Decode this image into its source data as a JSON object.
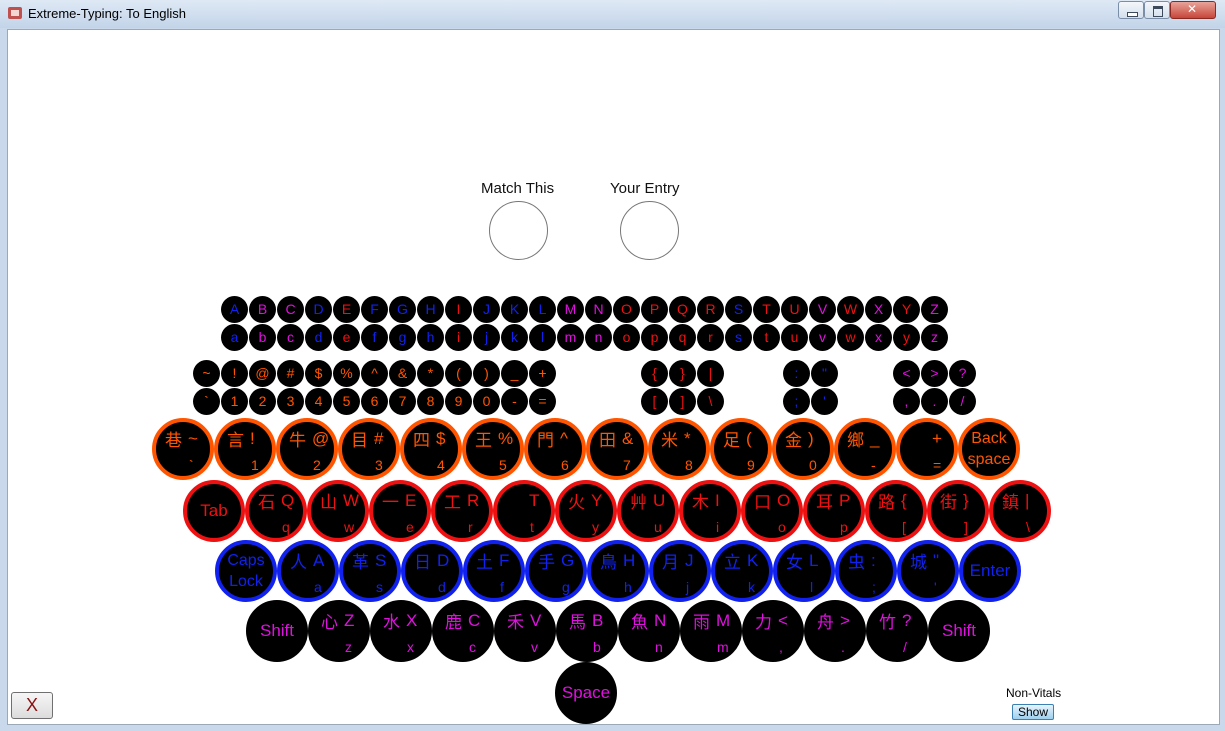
{
  "window": {
    "title": "Extreme-Typing: To English"
  },
  "labels": {
    "match": "Match This",
    "entry": "Your Entry"
  },
  "footer": {
    "close_label": "X",
    "nonvitals_label": "Non-Vitals",
    "show_label": "Show"
  },
  "colors": {
    "orange": "#ff5500",
    "red": "#ee1111",
    "blue": "#1122ee",
    "magenta": "#e010e0",
    "gray": "#888888"
  },
  "letters_upper": [
    "A",
    "B",
    "C",
    "D",
    "E",
    "F",
    "G",
    "H",
    "I",
    "J",
    "K",
    "L",
    "M",
    "N",
    "O",
    "P",
    "Q",
    "R",
    "S",
    "T",
    "U",
    "V",
    "W",
    "X",
    "Y",
    "Z"
  ],
  "letters_lower": [
    "a",
    "b",
    "c",
    "d",
    "e",
    "f",
    "g",
    "h",
    "i",
    "j",
    "k",
    "l",
    "m",
    "n",
    "o",
    "p",
    "q",
    "r",
    "s",
    "t",
    "u",
    "v",
    "w",
    "x",
    "y",
    "z"
  ],
  "letters_colors": [
    "blue",
    "magenta",
    "magenta",
    "blue",
    "red",
    "blue",
    "blue",
    "blue",
    "red",
    "blue",
    "blue",
    "blue",
    "magenta",
    "magenta",
    "red",
    "red",
    "red",
    "red",
    "blue",
    "red",
    "red",
    "magenta",
    "red",
    "magenta",
    "red",
    "magenta"
  ],
  "symbols_top": [
    "~",
    "!",
    "@",
    "#",
    "$",
    "%",
    "^",
    "&",
    "*",
    "(",
    ")",
    "_",
    "+"
  ],
  "symbols_bottom": [
    "`",
    "1",
    "2",
    "3",
    "4",
    "5",
    "6",
    "7",
    "8",
    "9",
    "0",
    "-",
    "="
  ],
  "brackets_top": [
    "{",
    "}",
    "|"
  ],
  "brackets_bottom": [
    "[",
    "]",
    "\\"
  ],
  "punct_top": [
    ":",
    "\""
  ],
  "punct_bottom": [
    ";",
    "'"
  ],
  "angle_top": [
    "<",
    ">",
    "?"
  ],
  "angle_bottom": [
    ",",
    ".",
    "/"
  ],
  "row_number": [
    {
      "t": "巷",
      "tr": "~",
      "bl": "`"
    },
    {
      "t": "言",
      "tr": "!",
      "bl": "1"
    },
    {
      "t": "牛",
      "tr": "@",
      "bl": "2"
    },
    {
      "t": "目",
      "tr": "#",
      "bl": "3"
    },
    {
      "t": "四",
      "tr": "$",
      "bl": "4"
    },
    {
      "t": "王",
      "tr": "%",
      "bl": "5"
    },
    {
      "t": "門",
      "tr": "^",
      "bl": "6"
    },
    {
      "t": "田",
      "tr": "&",
      "bl": "7"
    },
    {
      "t": "米",
      "tr": "*",
      "bl": "8"
    },
    {
      "t": "足",
      "tr": "(",
      "bl": "9"
    },
    {
      "t": "金",
      "tr": ")",
      "bl": "0"
    },
    {
      "t": "鄉",
      "tr": "_",
      "bl": "-"
    },
    {
      "t": "",
      "tr": "+",
      "bl": "="
    }
  ],
  "backspace_label": "Back space",
  "tab_label": "Tab",
  "row_top": [
    {
      "t": "石",
      "tr": "Q",
      "bl": "q"
    },
    {
      "t": "山",
      "tr": "W",
      "bl": "w"
    },
    {
      "t": "一",
      "tr": "E",
      "bl": "e"
    },
    {
      "t": "工",
      "tr": "R",
      "bl": "r"
    },
    {
      "t": "",
      "tr": "T",
      "bl": "t"
    },
    {
      "t": "火",
      "tr": "Y",
      "bl": "y"
    },
    {
      "t": "艸",
      "tr": "U",
      "bl": "u"
    },
    {
      "t": "木",
      "tr": "I",
      "bl": "i"
    },
    {
      "t": "口",
      "tr": "O",
      "bl": "o"
    },
    {
      "t": "耳",
      "tr": "P",
      "bl": "p"
    },
    {
      "t": "路",
      "tr": "{",
      "bl": "["
    },
    {
      "t": "街",
      "tr": "}",
      "bl": "]"
    },
    {
      "t": "鎮",
      "tr": "|",
      "bl": "\\"
    }
  ],
  "caps_label": "Caps Lock",
  "row_home": [
    {
      "t": "人",
      "tr": "A",
      "bl": "a"
    },
    {
      "t": "革",
      "tr": "S",
      "bl": "s"
    },
    {
      "t": "日",
      "tr": "D",
      "bl": "d"
    },
    {
      "t": "土",
      "tr": "F",
      "bl": "f"
    },
    {
      "t": "手",
      "tr": "G",
      "bl": "g"
    },
    {
      "t": "鳥",
      "tr": "H",
      "bl": "h"
    },
    {
      "t": "月",
      "tr": "J",
      "bl": "j"
    },
    {
      "t": "立",
      "tr": "K",
      "bl": "k"
    },
    {
      "t": "女",
      "tr": "L",
      "bl": "l"
    },
    {
      "t": "虫",
      "tr": ":",
      "bl": ";"
    },
    {
      "t": "城",
      "tr": "\"",
      "bl": "'"
    }
  ],
  "enter_label": "Enter",
  "shift_label": "Shift",
  "row_bottom": [
    {
      "t": "心",
      "tr": "Z",
      "bl": "z"
    },
    {
      "t": "水",
      "tr": "X",
      "bl": "x"
    },
    {
      "t": "鹿",
      "tr": "C",
      "bl": "c"
    },
    {
      "t": "禾",
      "tr": "V",
      "bl": "v"
    },
    {
      "t": "馬",
      "tr": "B",
      "bl": "b"
    },
    {
      "t": "魚",
      "tr": "N",
      "bl": "n"
    },
    {
      "t": "雨",
      "tr": "M",
      "bl": "m"
    },
    {
      "t": "力",
      "tr": "<",
      "bl": ","
    },
    {
      "t": "舟",
      "tr": ">",
      "bl": "."
    },
    {
      "t": "竹",
      "tr": "?",
      "bl": "/"
    }
  ],
  "space_label": "Space"
}
